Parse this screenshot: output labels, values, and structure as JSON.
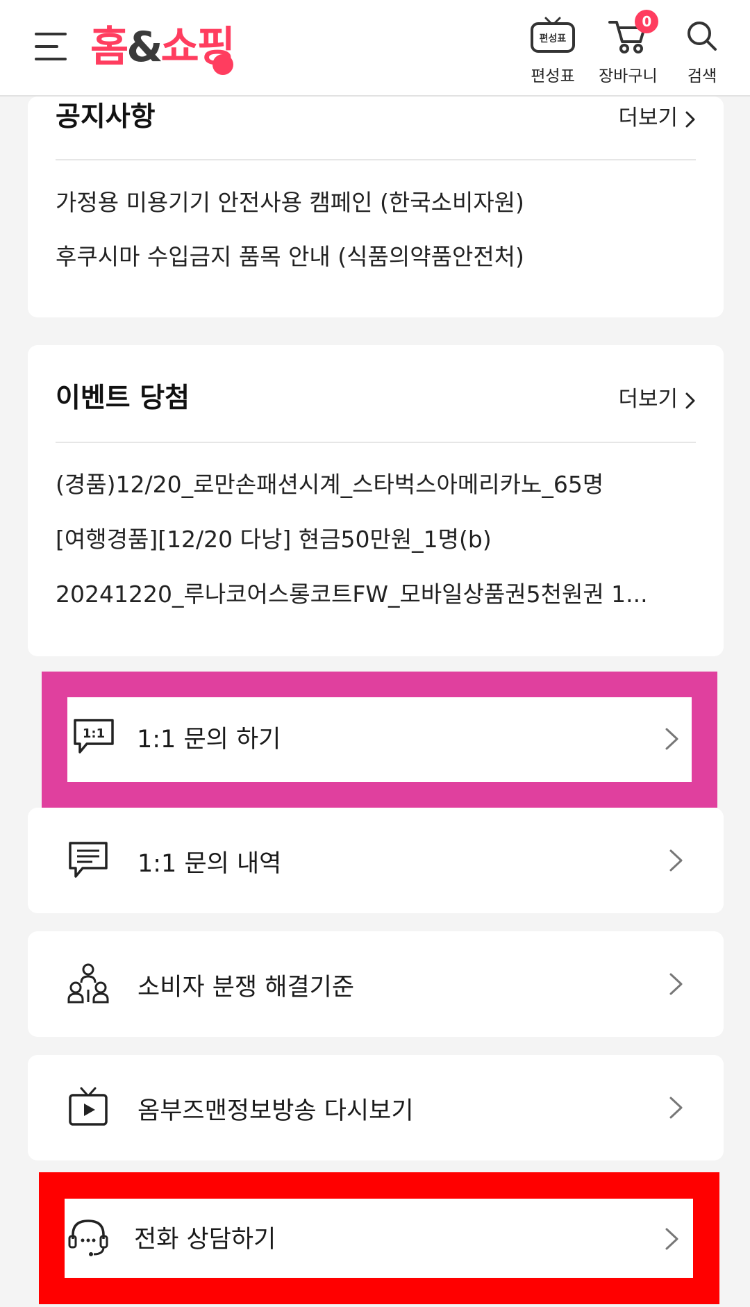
{
  "header": {
    "logo_text": "홈&쇼핑",
    "brand_color": "#ff3d5f",
    "schedule_label": "편성표",
    "schedule_icon_text": "편성표",
    "cart_label": "장바구니",
    "cart_count": "0",
    "search_label": "검색"
  },
  "notice": {
    "title": "공지사항",
    "more": "더보기",
    "items": [
      "가정용 미용기기 안전사용 캠페인 (한국소비자원)",
      "후쿠시마 수입금지 품목 안내 (식품의약품안전처)"
    ]
  },
  "event": {
    "title": "이벤트 당첨",
    "more": "더보기",
    "items": [
      "(경품)12/20_로만손패션시계_스타벅스아메리카노_65명",
      "[여행경품][12/20 다낭] 현금50만원_1명(b)",
      "20241220_루나코어스롱코트FW_모바일상품권5천원권 1..."
    ]
  },
  "menu": {
    "inquiry": "1:1 문의 하기",
    "inquiry_icon_text": "1:1",
    "history": "1:1 문의 내역",
    "dispute": "소비자 분쟁 해결기준",
    "replay": "옴부즈맨정보방송 다시보기",
    "phone": "전화 상담하기"
  },
  "highlights": {
    "pink": "#e0409e",
    "red": "#ff0000"
  }
}
